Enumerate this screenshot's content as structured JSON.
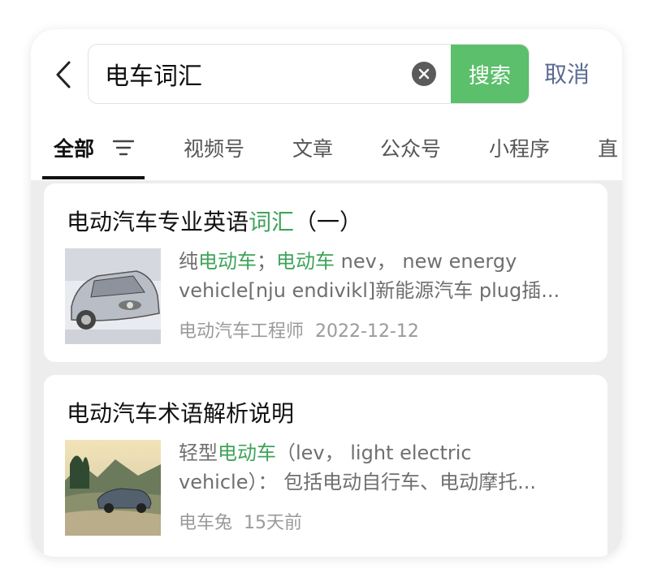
{
  "search": {
    "query": "电车词汇",
    "search_button": "搜索",
    "cancel": "取消"
  },
  "tabs": [
    {
      "label": "全部",
      "active": true
    },
    {
      "label": "视频号"
    },
    {
      "label": "文章"
    },
    {
      "label": "公众号"
    },
    {
      "label": "小程序"
    },
    {
      "label": "直"
    }
  ],
  "results": [
    {
      "title_plain": "电动汽车专业英语",
      "title_highlight": "词汇",
      "title_suffix": "（一）",
      "snippet_line1": [
        {
          "text": "纯",
          "hl": false
        },
        {
          "text": "电动车",
          "hl": true
        },
        {
          "text": "；",
          "hl": false
        },
        {
          "text": "电动车",
          "hl": true
        },
        {
          "text": " nev，  new energy",
          "hl": false
        }
      ],
      "snippet_line2": "vehicle[nju endivikl]新能源汽车 plug插...",
      "source": "电动汽车工程师",
      "date": "2022-12-12"
    },
    {
      "title_plain": "电动汽车术语解析说明",
      "snippet_line1": [
        {
          "text": "轻型",
          "hl": false
        },
        {
          "text": "电动车",
          "hl": true
        },
        {
          "text": "（lev，  light electric",
          "hl": false
        }
      ],
      "snippet_line2": "vehicle）： 包括电动自行车、电动摩托...",
      "source": "电车兔",
      "date": "15天前"
    }
  ],
  "colors": {
    "accent": "#5bbf6b",
    "highlight": "#3fa35a",
    "cancel": "#5b6a92"
  },
  "icons": {
    "back": "chevron-left-icon",
    "clear": "clear-circle-icon",
    "filter": "filter-lines-icon"
  }
}
